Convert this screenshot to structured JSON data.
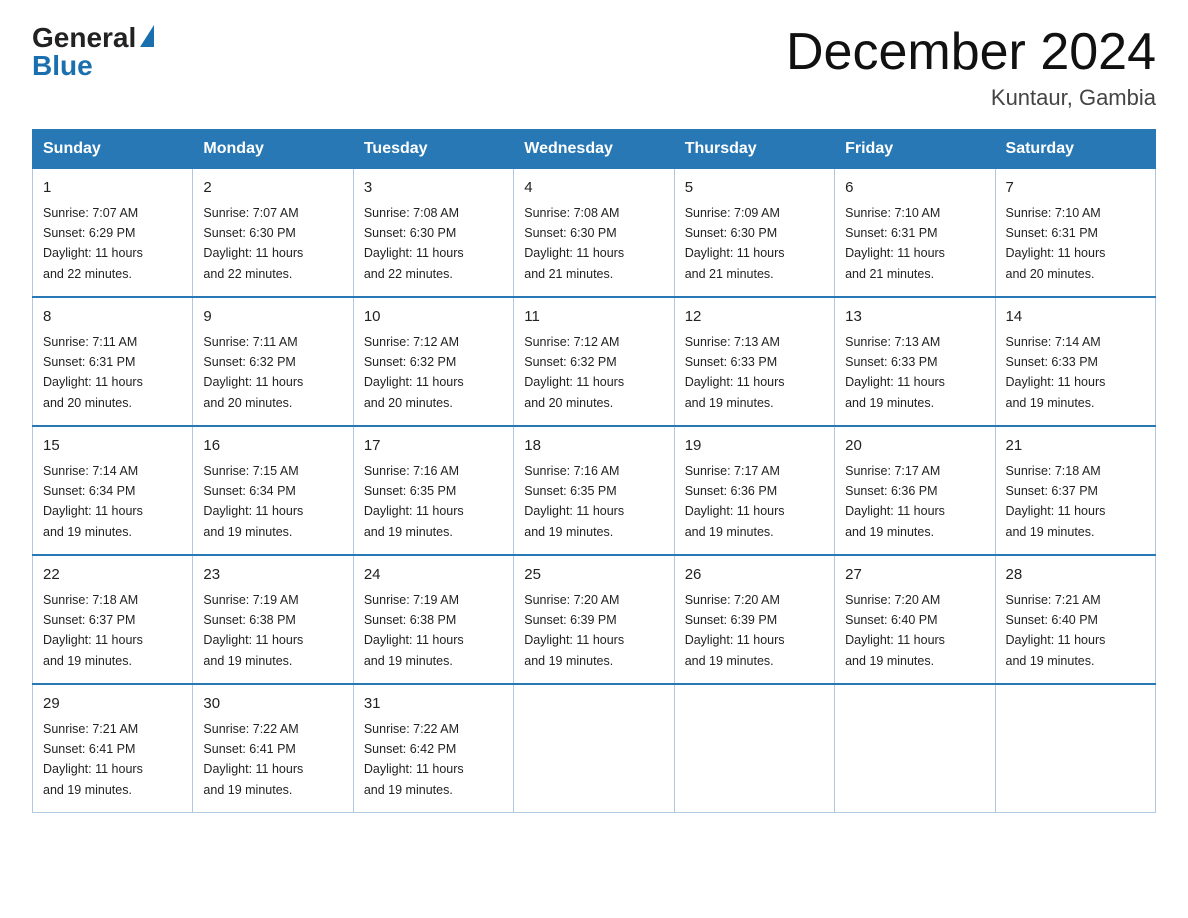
{
  "header": {
    "logo_general": "General",
    "logo_blue": "Blue",
    "title": "December 2024",
    "location": "Kuntaur, Gambia"
  },
  "calendar": {
    "days_of_week": [
      "Sunday",
      "Monday",
      "Tuesday",
      "Wednesday",
      "Thursday",
      "Friday",
      "Saturday"
    ],
    "weeks": [
      [
        {
          "day": "1",
          "sunrise": "7:07 AM",
          "sunset": "6:29 PM",
          "daylight": "11 hours and 22 minutes."
        },
        {
          "day": "2",
          "sunrise": "7:07 AM",
          "sunset": "6:30 PM",
          "daylight": "11 hours and 22 minutes."
        },
        {
          "day": "3",
          "sunrise": "7:08 AM",
          "sunset": "6:30 PM",
          "daylight": "11 hours and 22 minutes."
        },
        {
          "day": "4",
          "sunrise": "7:08 AM",
          "sunset": "6:30 PM",
          "daylight": "11 hours and 21 minutes."
        },
        {
          "day": "5",
          "sunrise": "7:09 AM",
          "sunset": "6:30 PM",
          "daylight": "11 hours and 21 minutes."
        },
        {
          "day": "6",
          "sunrise": "7:10 AM",
          "sunset": "6:31 PM",
          "daylight": "11 hours and 21 minutes."
        },
        {
          "day": "7",
          "sunrise": "7:10 AM",
          "sunset": "6:31 PM",
          "daylight": "11 hours and 20 minutes."
        }
      ],
      [
        {
          "day": "8",
          "sunrise": "7:11 AM",
          "sunset": "6:31 PM",
          "daylight": "11 hours and 20 minutes."
        },
        {
          "day": "9",
          "sunrise": "7:11 AM",
          "sunset": "6:32 PM",
          "daylight": "11 hours and 20 minutes."
        },
        {
          "day": "10",
          "sunrise": "7:12 AM",
          "sunset": "6:32 PM",
          "daylight": "11 hours and 20 minutes."
        },
        {
          "day": "11",
          "sunrise": "7:12 AM",
          "sunset": "6:32 PM",
          "daylight": "11 hours and 20 minutes."
        },
        {
          "day": "12",
          "sunrise": "7:13 AM",
          "sunset": "6:33 PM",
          "daylight": "11 hours and 19 minutes."
        },
        {
          "day": "13",
          "sunrise": "7:13 AM",
          "sunset": "6:33 PM",
          "daylight": "11 hours and 19 minutes."
        },
        {
          "day": "14",
          "sunrise": "7:14 AM",
          "sunset": "6:33 PM",
          "daylight": "11 hours and 19 minutes."
        }
      ],
      [
        {
          "day": "15",
          "sunrise": "7:14 AM",
          "sunset": "6:34 PM",
          "daylight": "11 hours and 19 minutes."
        },
        {
          "day": "16",
          "sunrise": "7:15 AM",
          "sunset": "6:34 PM",
          "daylight": "11 hours and 19 minutes."
        },
        {
          "day": "17",
          "sunrise": "7:16 AM",
          "sunset": "6:35 PM",
          "daylight": "11 hours and 19 minutes."
        },
        {
          "day": "18",
          "sunrise": "7:16 AM",
          "sunset": "6:35 PM",
          "daylight": "11 hours and 19 minutes."
        },
        {
          "day": "19",
          "sunrise": "7:17 AM",
          "sunset": "6:36 PM",
          "daylight": "11 hours and 19 minutes."
        },
        {
          "day": "20",
          "sunrise": "7:17 AM",
          "sunset": "6:36 PM",
          "daylight": "11 hours and 19 minutes."
        },
        {
          "day": "21",
          "sunrise": "7:18 AM",
          "sunset": "6:37 PM",
          "daylight": "11 hours and 19 minutes."
        }
      ],
      [
        {
          "day": "22",
          "sunrise": "7:18 AM",
          "sunset": "6:37 PM",
          "daylight": "11 hours and 19 minutes."
        },
        {
          "day": "23",
          "sunrise": "7:19 AM",
          "sunset": "6:38 PM",
          "daylight": "11 hours and 19 minutes."
        },
        {
          "day": "24",
          "sunrise": "7:19 AM",
          "sunset": "6:38 PM",
          "daylight": "11 hours and 19 minutes."
        },
        {
          "day": "25",
          "sunrise": "7:20 AM",
          "sunset": "6:39 PM",
          "daylight": "11 hours and 19 minutes."
        },
        {
          "day": "26",
          "sunrise": "7:20 AM",
          "sunset": "6:39 PM",
          "daylight": "11 hours and 19 minutes."
        },
        {
          "day": "27",
          "sunrise": "7:20 AM",
          "sunset": "6:40 PM",
          "daylight": "11 hours and 19 minutes."
        },
        {
          "day": "28",
          "sunrise": "7:21 AM",
          "sunset": "6:40 PM",
          "daylight": "11 hours and 19 minutes."
        }
      ],
      [
        {
          "day": "29",
          "sunrise": "7:21 AM",
          "sunset": "6:41 PM",
          "daylight": "11 hours and 19 minutes."
        },
        {
          "day": "30",
          "sunrise": "7:22 AM",
          "sunset": "6:41 PM",
          "daylight": "11 hours and 19 minutes."
        },
        {
          "day": "31",
          "sunrise": "7:22 AM",
          "sunset": "6:42 PM",
          "daylight": "11 hours and 19 minutes."
        },
        null,
        null,
        null,
        null
      ]
    ]
  }
}
